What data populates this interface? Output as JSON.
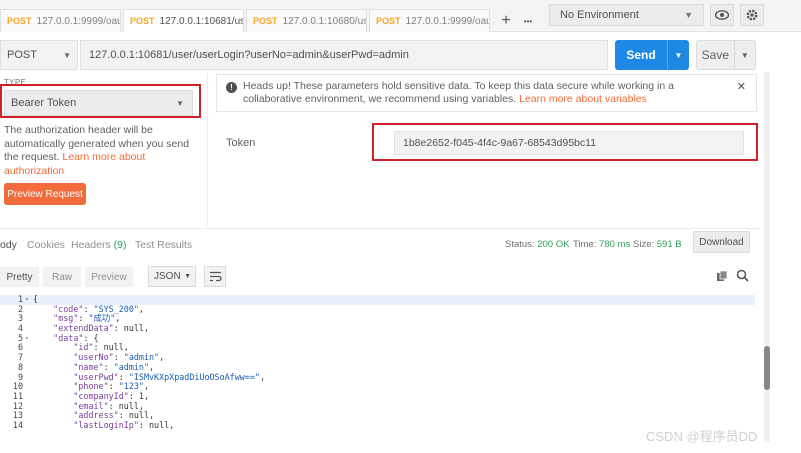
{
  "tabs": [
    {
      "method": "POST",
      "label": "127.0.0.1:9999/oaut.",
      "unsaved": true,
      "active": false
    },
    {
      "method": "POST",
      "label": "127.0.0.1:10681/us...",
      "unsaved": true,
      "active": true
    },
    {
      "method": "POST",
      "label": "127.0.0.1:10680/us...",
      "unsaved": true,
      "active": false
    },
    {
      "method": "POST",
      "label": "127.0.0.1:9999/oaut.",
      "unsaved": false,
      "active": false
    }
  ],
  "tab_add": "+",
  "tab_more": "•••",
  "environment": {
    "selected": "No Environment"
  },
  "request": {
    "method": "POST",
    "url": "127.0.0.1:10681/user/userLogin?userNo=admin&userPwd=admin",
    "send_label": "Send",
    "save_label": "Save"
  },
  "auth": {
    "type_label": "TYPE",
    "type_value": "Bearer Token",
    "description": "The authorization header will be automatically generated when you send the request.",
    "learn_more": "Learn more about authorization",
    "preview_label": "Preview Request"
  },
  "notice": {
    "text": "Heads up! These parameters hold sensitive data. To keep this data secure while working in a collaborative environment, we recommend using variables.",
    "link": "Learn more about variables"
  },
  "token": {
    "label": "Token",
    "value": "1b8e2652-f045-4f4c-9a67-68543d95bc11"
  },
  "response": {
    "tabs": [
      {
        "label": "ody",
        "active": true
      },
      {
        "label": "Cookies"
      },
      {
        "label": "Headers",
        "count": "(9)"
      },
      {
        "label": "Test Results"
      }
    ],
    "status_label": "Status:",
    "status_value": "200 OK",
    "time_label": "Time:",
    "time_value": "780 ms",
    "size_label": "Size:",
    "size_value": "591 B",
    "download_label": "Download",
    "formats": [
      "Pretty",
      "Raw",
      "Preview"
    ],
    "format_type": "JSON"
  },
  "code_lines": [
    {
      "n": "1",
      "fold": true,
      "text": "{"
    },
    {
      "n": "2",
      "text": "    \"code\": \"SYS_200\","
    },
    {
      "n": "3",
      "text": "    \"msg\": \"成功\","
    },
    {
      "n": "4",
      "text": "    \"extendData\": null,"
    },
    {
      "n": "5",
      "fold": true,
      "text": "    \"data\": {"
    },
    {
      "n": "6",
      "text": "        \"id\": null,"
    },
    {
      "n": "7",
      "text": "        \"userNo\": \"admin\","
    },
    {
      "n": "8",
      "text": "        \"name\": \"admin\","
    },
    {
      "n": "9",
      "text": "        \"userPwd\": \"ISMvKXpXpadDiUoOSoAfww==\","
    },
    {
      "n": "10",
      "text": "        \"phone\": \"123\","
    },
    {
      "n": "11",
      "text": "        \"companyId\": 1,"
    },
    {
      "n": "12",
      "text": "        \"email\": null,"
    },
    {
      "n": "13",
      "text": "        \"address\": null,"
    },
    {
      "n": "14",
      "text": "        \"lastLoginIp\": null,"
    }
  ],
  "watermark": "CSDN @程序员DD"
}
